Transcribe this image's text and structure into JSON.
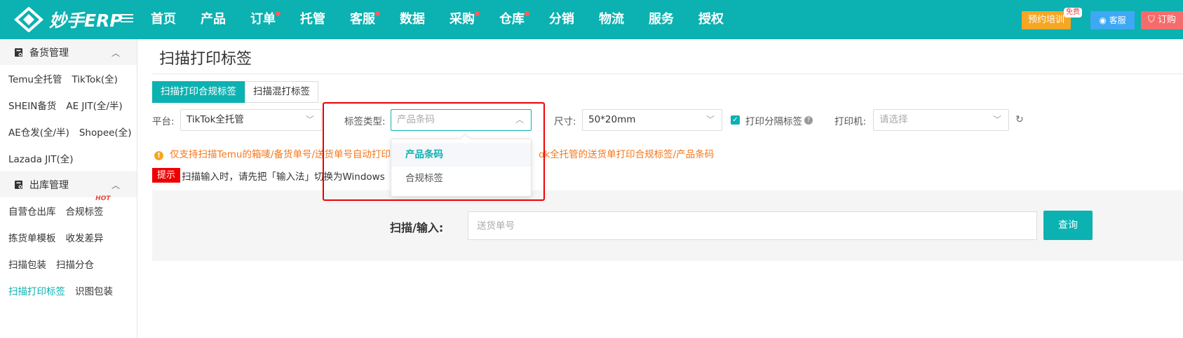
{
  "app": {
    "logo_text": "妙手ERP"
  },
  "nav": {
    "items": [
      {
        "label": "首页",
        "dot": false
      },
      {
        "label": "产品",
        "dot": false
      },
      {
        "label": "订单",
        "dot": true
      },
      {
        "label": "托管",
        "dot": false
      },
      {
        "label": "客服",
        "dot": true
      },
      {
        "label": "数据",
        "dot": false
      },
      {
        "label": "采购",
        "dot": true
      },
      {
        "label": "仓库",
        "dot": true
      },
      {
        "label": "分销",
        "dot": false
      },
      {
        "label": "物流",
        "dot": false
      },
      {
        "label": "服务",
        "dot": false
      },
      {
        "label": "授权",
        "dot": false
      }
    ],
    "train_label": "预约培训",
    "free_badge": "免费",
    "service_label": "客服",
    "order_label": "订购"
  },
  "sidebar": {
    "groups": [
      {
        "title": "备货管理",
        "chevron": "up",
        "rows": [
          [
            "Temu全托管",
            "TikTok(全)"
          ],
          [
            "SHEIN备货",
            "AE JIT(全/半)"
          ],
          [
            "AE仓发(全/半)",
            "Shopee(全)"
          ],
          [
            "Lazada JIT(全)"
          ]
        ]
      },
      {
        "title": "出库管理",
        "chevron": "up",
        "rows": [
          [
            "自营仓出库",
            "合规标签"
          ],
          [
            "拣货单模板",
            "收发差异"
          ],
          [
            "扫描包装",
            "扫描分仓"
          ],
          [
            "扫描打印标签",
            "识图包装"
          ]
        ]
      }
    ],
    "hot_badge": "HOT",
    "active_item": "扫描打印标签"
  },
  "page": {
    "title": "扫描打印标签",
    "tabs": [
      "扫描打印合规标签",
      "扫描混打标签"
    ],
    "active_tab": 0,
    "filters": {
      "platform_label": "平台:",
      "platform_value": "TikTok全托管",
      "label_type_label": "标签类型:",
      "label_type_placeholder": "产品条码",
      "size_label": "尺寸:",
      "size_value": "50*20mm",
      "print_separator_label": "打印分隔标签",
      "print_separator_checked": true,
      "printer_label": "打印机:",
      "printer_placeholder": "请选择"
    },
    "dropdown_options": [
      "产品条码",
      "合规标签"
    ],
    "dropdown_selected": 0,
    "notice_before": "仅支持扫描Temu的箱唛/备货单号/送货单号自动打印",
    "notice_after": "ok全托管的送货单打印合规标签/产品条码",
    "tip_badge": "提示",
    "tip_text": "扫描输入时，请先把「输入法」切换为Windows",
    "scan_label": "扫描/输入:",
    "scan_placeholder": "送货单号",
    "query_label": "查询"
  },
  "colors": {
    "brand": "#0cb1b1",
    "highlight": "#ee0000",
    "notice": "#f5761b"
  }
}
